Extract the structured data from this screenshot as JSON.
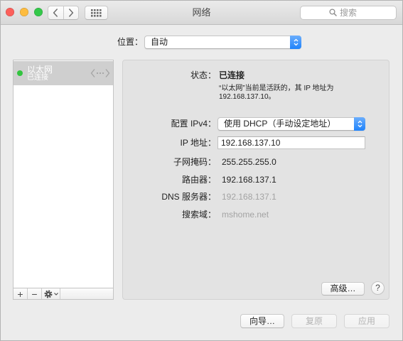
{
  "window": {
    "title": "网络",
    "search_placeholder": "搜索"
  },
  "toolbar": {
    "back_icon": "chevron-left-icon",
    "forward_icon": "chevron-right-icon",
    "show_all_icon": "grid-icon",
    "search_icon": "magnifier-icon"
  },
  "location": {
    "label": "位置：",
    "value": "自动"
  },
  "sidebar": {
    "services": [
      {
        "name": "以太网",
        "status": "已连接",
        "icon": "ethernet-icon"
      }
    ],
    "add_label": "+",
    "remove_label": "−",
    "actions_icon": "gear-icon"
  },
  "detail": {
    "status": {
      "label": "状态：",
      "value": "已连接",
      "description": [
        "“以太网”当前是活跃的，其 IP 地址为",
        "192.168.137.10。"
      ]
    },
    "configure_ipv4": {
      "label": "配置 IPv4：",
      "value": "使用 DHCP（手动设定地址）"
    },
    "ip_address": {
      "label": "IP 地址：",
      "value": "192.168.137.10"
    },
    "subnet_mask": {
      "label": "子网掩码：",
      "value": "255.255.255.0"
    },
    "router": {
      "label": "路由器：",
      "value": "192.168.137.1"
    },
    "dns_server": {
      "label": "DNS 服务器：",
      "value": "192.168.137.1"
    },
    "search_domains": {
      "label": "搜索域：",
      "value": "mshome.net"
    },
    "advanced_button": "高级…",
    "help_button": "?"
  },
  "footer": {
    "assist_button": "向导…",
    "revert_button": "复原",
    "apply_button": "应用"
  },
  "colors": {
    "accent": "#1f83fb",
    "status_connected": "#33c43f",
    "close": "#fc605b",
    "minimize": "#fdbc40",
    "zoom": "#34c84a"
  }
}
